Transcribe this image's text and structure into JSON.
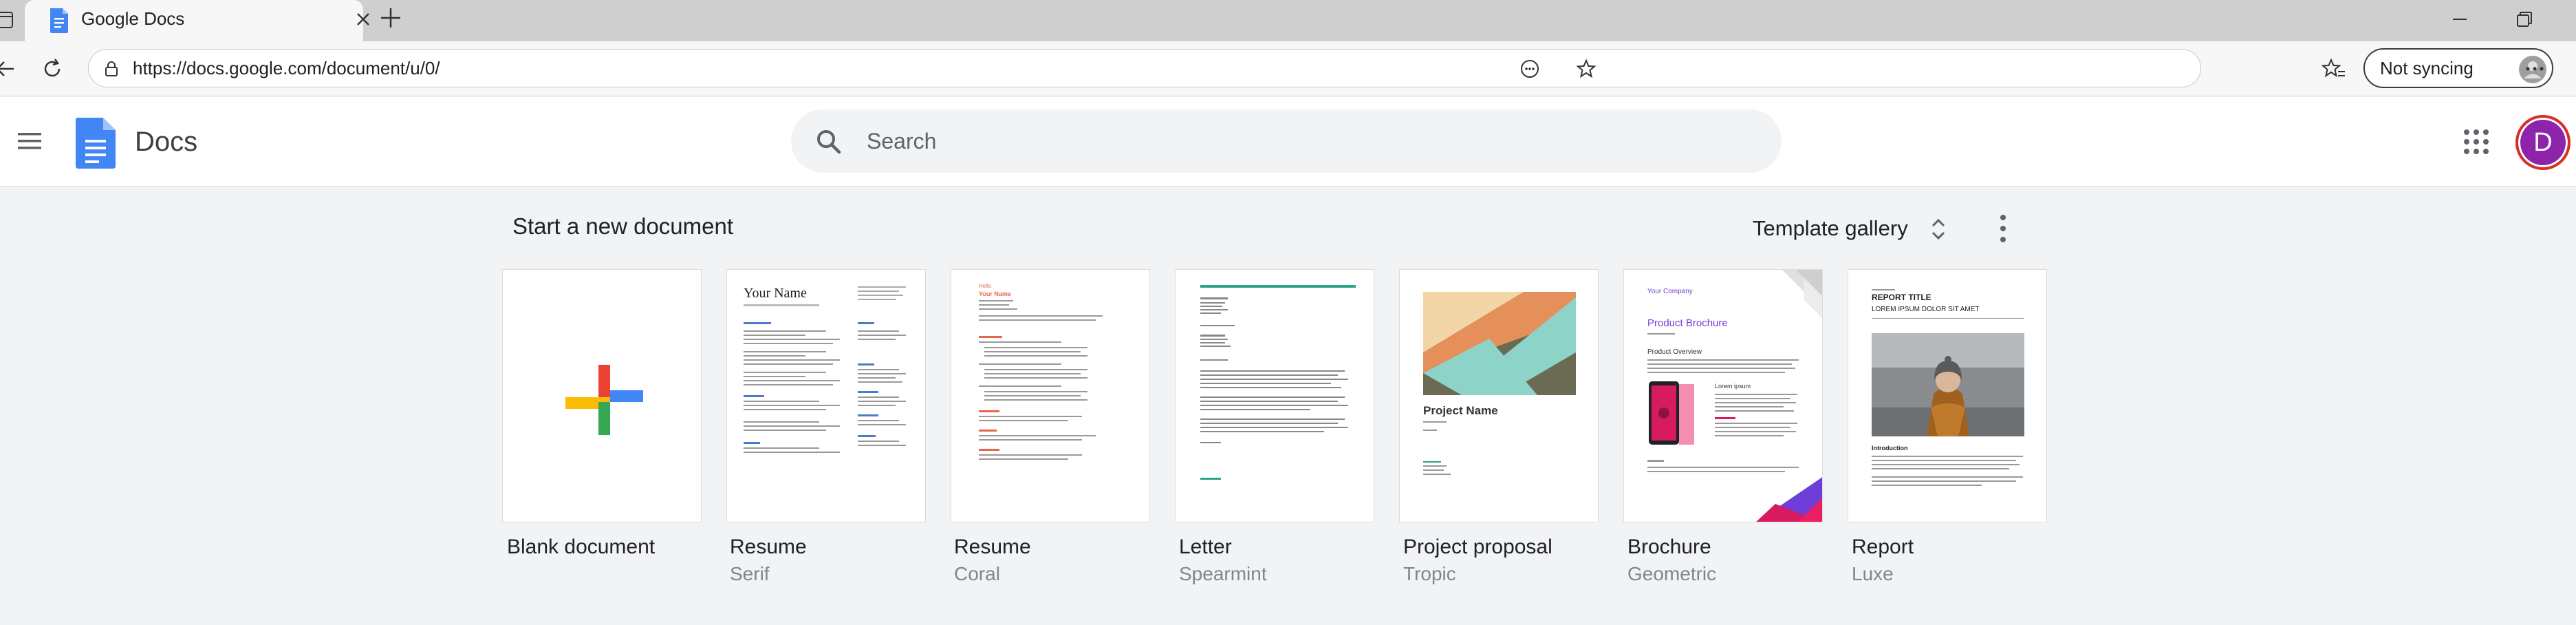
{
  "browser": {
    "tab_title": "Google Docs",
    "url": "https://docs.google.com/document/u/0/",
    "sync_label": "Not syncing"
  },
  "header": {
    "app_name": "Docs",
    "search_placeholder": "Search",
    "avatar_letter": "D"
  },
  "templates_section": {
    "title": "Start a new document",
    "gallery_label": "Template gallery",
    "items": [
      {
        "name": "Blank document",
        "subtitle": ""
      },
      {
        "name": "Resume",
        "subtitle": "Serif"
      },
      {
        "name": "Resume",
        "subtitle": "Coral"
      },
      {
        "name": "Letter",
        "subtitle": "Spearmint"
      },
      {
        "name": "Project proposal",
        "subtitle": "Tropic"
      },
      {
        "name": "Brochure",
        "subtitle": "Geometric"
      },
      {
        "name": "Report",
        "subtitle": "Luxe"
      }
    ]
  },
  "thumbnails": {
    "serif_name": "Your Name",
    "coral_name": "Your Name",
    "coral_hello": "Hello",
    "proposal_title": "Project Name",
    "brochure_company": "Your Company",
    "brochure_title": "Product Brochure",
    "brochure_overview": "Product Overview",
    "brochure_lorem": "Lorem ipsum",
    "report_title": "REPORT TITLE",
    "report_subtitle": "LOREM IPSUM DOLOR SIT AMET",
    "report_intro": "Introduction"
  },
  "colors": {
    "docs_blue": "#4285f4",
    "google_red": "#ea4335",
    "google_yellow": "#fbbc04",
    "google_green": "#34a853",
    "coral": "#e8664b",
    "spearmint": "#2aa58a",
    "tropic_teal": "#8dd3c8",
    "geometric_purple": "#6f3ed8",
    "geometric_pink": "#d81b60",
    "avatar_purple": "#8e24aa"
  }
}
